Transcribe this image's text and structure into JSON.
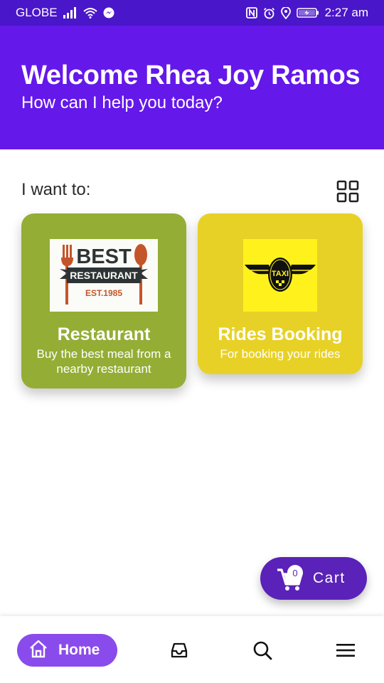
{
  "status_bar": {
    "carrier": "GLOBE",
    "time": "2:27 am",
    "icons": [
      "signal-icon",
      "wifi-icon",
      "messenger-icon",
      "nfc-icon",
      "alarm-icon",
      "location-icon",
      "battery-icon"
    ]
  },
  "header": {
    "title": "Welcome Rhea Joy Ramos",
    "subtitle": "How can I help you today?",
    "background": "#6418ea"
  },
  "services": {
    "label": "I want to:",
    "items": [
      {
        "name": "Restaurant",
        "description": "Buy the best meal from a nearby restaurant",
        "color": "#94ad35",
        "image": {
          "line1": "BEST",
          "banner": "RESTAURANT",
          "est": "EST.1985"
        }
      },
      {
        "name": "Rides Booking",
        "description": "For booking your rides",
        "color": "#e8d126",
        "image": {
          "text": "TAXI"
        }
      }
    ]
  },
  "cart": {
    "label": "Cart",
    "count": "0",
    "color": "#5a22b8"
  },
  "bottom_nav": {
    "home_label": "Home",
    "items": [
      "home-icon",
      "inbox-icon",
      "search-icon",
      "menu-icon"
    ],
    "accent": "#8a4bec"
  }
}
